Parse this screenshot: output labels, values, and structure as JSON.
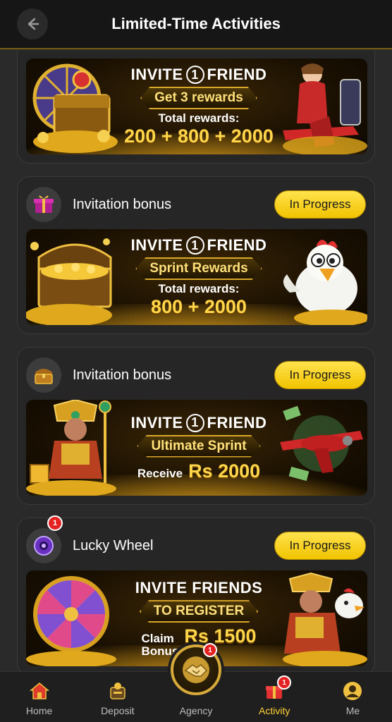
{
  "header": {
    "title": "Limited-Time Activities",
    "back_icon": "arrow-left-icon"
  },
  "cards": [
    {
      "banner": {
        "line1_pre": "INVITE",
        "line1_num": "1",
        "line1_post": "FRIEND",
        "ribbon": "Get 3 rewards",
        "small": "Total rewards:",
        "big": "200 + 800 + 2000"
      }
    },
    {
      "title": "Invitation bonus",
      "status": "In Progress",
      "icon": "gift-box-icon",
      "banner": {
        "line1_pre": "INVITE",
        "line1_num": "1",
        "line1_post": "FRIEND",
        "ribbon": "Sprint Rewards",
        "small": "Total rewards:",
        "big": "800 + 2000"
      }
    },
    {
      "title": "Invitation bonus",
      "status": "In Progress",
      "icon": "treasure-chest-icon",
      "banner": {
        "line1_pre": "INVITE",
        "line1_num": "1",
        "line1_post": "FRIEND",
        "ribbon": "Ultimate Sprint",
        "receive_label": "Receive",
        "big": "Rs 2000"
      }
    },
    {
      "title": "Lucky Wheel",
      "status": "In Progress",
      "icon": "lucky-wheel-icon",
      "badge": "1",
      "banner": {
        "line1": "INVITE FRIENDS",
        "ribbon": "TO REGISTER",
        "claim_label_1": "Claim",
        "claim_label_2": "Bonus",
        "big": "Rs 1500"
      }
    }
  ],
  "nav": {
    "items": [
      {
        "label": "Home",
        "icon": "home-icon"
      },
      {
        "label": "Deposit",
        "icon": "deposit-icon"
      },
      {
        "label": "Agency",
        "icon": "handshake-icon"
      },
      {
        "label": "Activity",
        "icon": "gift-icon",
        "badge": "1"
      },
      {
        "label": "Me",
        "icon": "profile-icon"
      }
    ],
    "active": "Activity"
  },
  "colors": {
    "accent": "#ffd233",
    "pill": "#f5cf1a",
    "background": "#2a2a2a",
    "badge": "#e52222"
  }
}
